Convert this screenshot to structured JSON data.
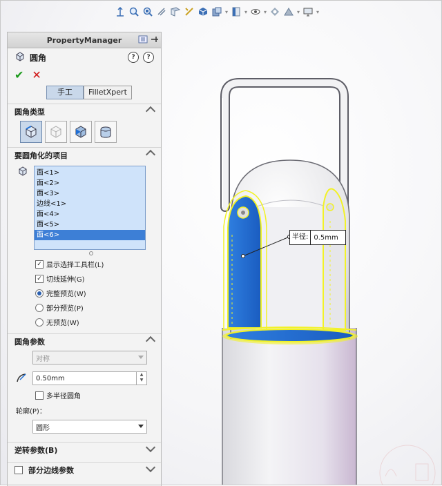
{
  "panel": {
    "title": "PropertyManager",
    "feature_name": "圆角",
    "help_icon_1": "?",
    "help_icon_2": "?",
    "ok_symbol": "✔",
    "cancel_symbol": "✕",
    "tabs": [
      {
        "label": "手工",
        "active": true
      },
      {
        "label": "FilletXpert",
        "active": false
      }
    ]
  },
  "fillet_type": {
    "heading": "圆角类型",
    "buttons": [
      {
        "icon": "constant-size-fillet-icon",
        "selected": true
      },
      {
        "icon": "variable-size-fillet-icon",
        "selected": false
      },
      {
        "icon": "face-fillet-icon",
        "selected": false
      },
      {
        "icon": "full-round-fillet-icon",
        "selected": false
      }
    ]
  },
  "items_to_fillet": {
    "heading": "要圆角化的项目",
    "list": [
      "面<1>",
      "面<2>",
      "面<3>",
      "边线<1>",
      "面<4>",
      "面<5>",
      "面<6>"
    ],
    "highlighted_index": 6,
    "options": {
      "show_selection_toolbar": {
        "label": "显示选择工具栏(L)",
        "checked": true
      },
      "tangent_propagation": {
        "label": "切线延伸(G)",
        "checked": true
      }
    },
    "preview": {
      "full": {
        "label": "完整预览(W)",
        "selected": true
      },
      "partial": {
        "label": "部分预览(P)",
        "selected": false
      },
      "none": {
        "label": "无预览(W)",
        "selected": false
      }
    }
  },
  "fillet_params": {
    "heading": "圆角参数",
    "method": "对称",
    "radius": "0.50mm",
    "spin_up": "▲",
    "spin_down": "▼",
    "multi_radius": {
      "label": "多半径圆角",
      "checked": false
    },
    "profile_label": "轮廓(P)：",
    "profile_value": "圆形"
  },
  "reverse_params": {
    "heading": "逆转参数(B)"
  },
  "partial_edge_params": {
    "heading": "部分边线参数",
    "checked": false
  },
  "callout": {
    "label": "半径:",
    "value": "0.5mm"
  },
  "colors": {
    "selection_blue": "#1f6fd6",
    "highlight_yellow": "#f2f226",
    "ok_green": "#1a9a1a",
    "cancel_red": "#d01818"
  }
}
